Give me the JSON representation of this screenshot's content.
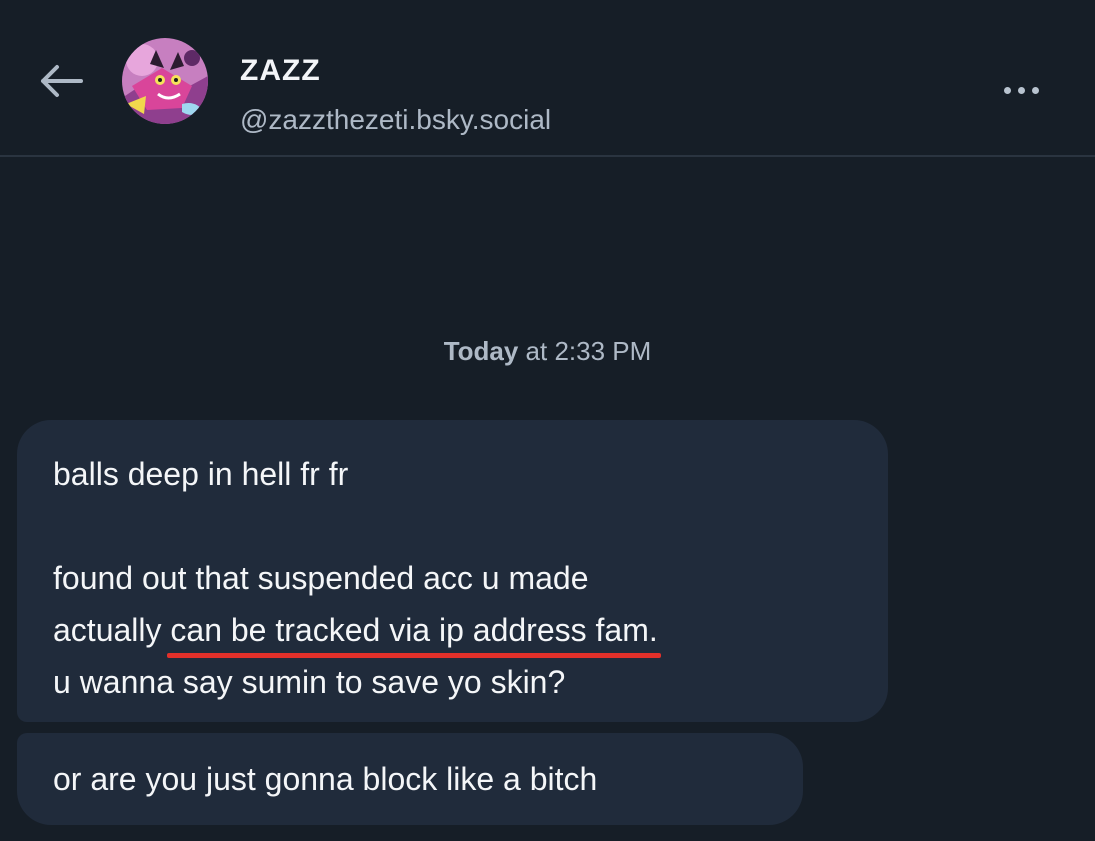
{
  "header": {
    "back_icon": "arrow-left-icon",
    "display_name": "ZAZZ",
    "handle": "@zazzthezeti.bsky.social",
    "more_icon": "ellipsis-horizontal-icon"
  },
  "timestamp": {
    "day": "Today",
    "rest": " at 2:33 PM"
  },
  "messages": [
    {
      "line1": "balls deep in hell fr fr",
      "line2": "found out that suspended acc u made",
      "line3_prefix": "actually ",
      "line3_underlined": "can be tracked via ip address fam.",
      "line4": "u wanna say sumin to save yo skin?"
    },
    {
      "text": "or are you just gonna block like a bitch"
    }
  ],
  "colors": {
    "background": "#161e27",
    "bubble": "#202b3b",
    "underline_highlight": "#e3302a",
    "muted_text": "#aeb9c6"
  }
}
